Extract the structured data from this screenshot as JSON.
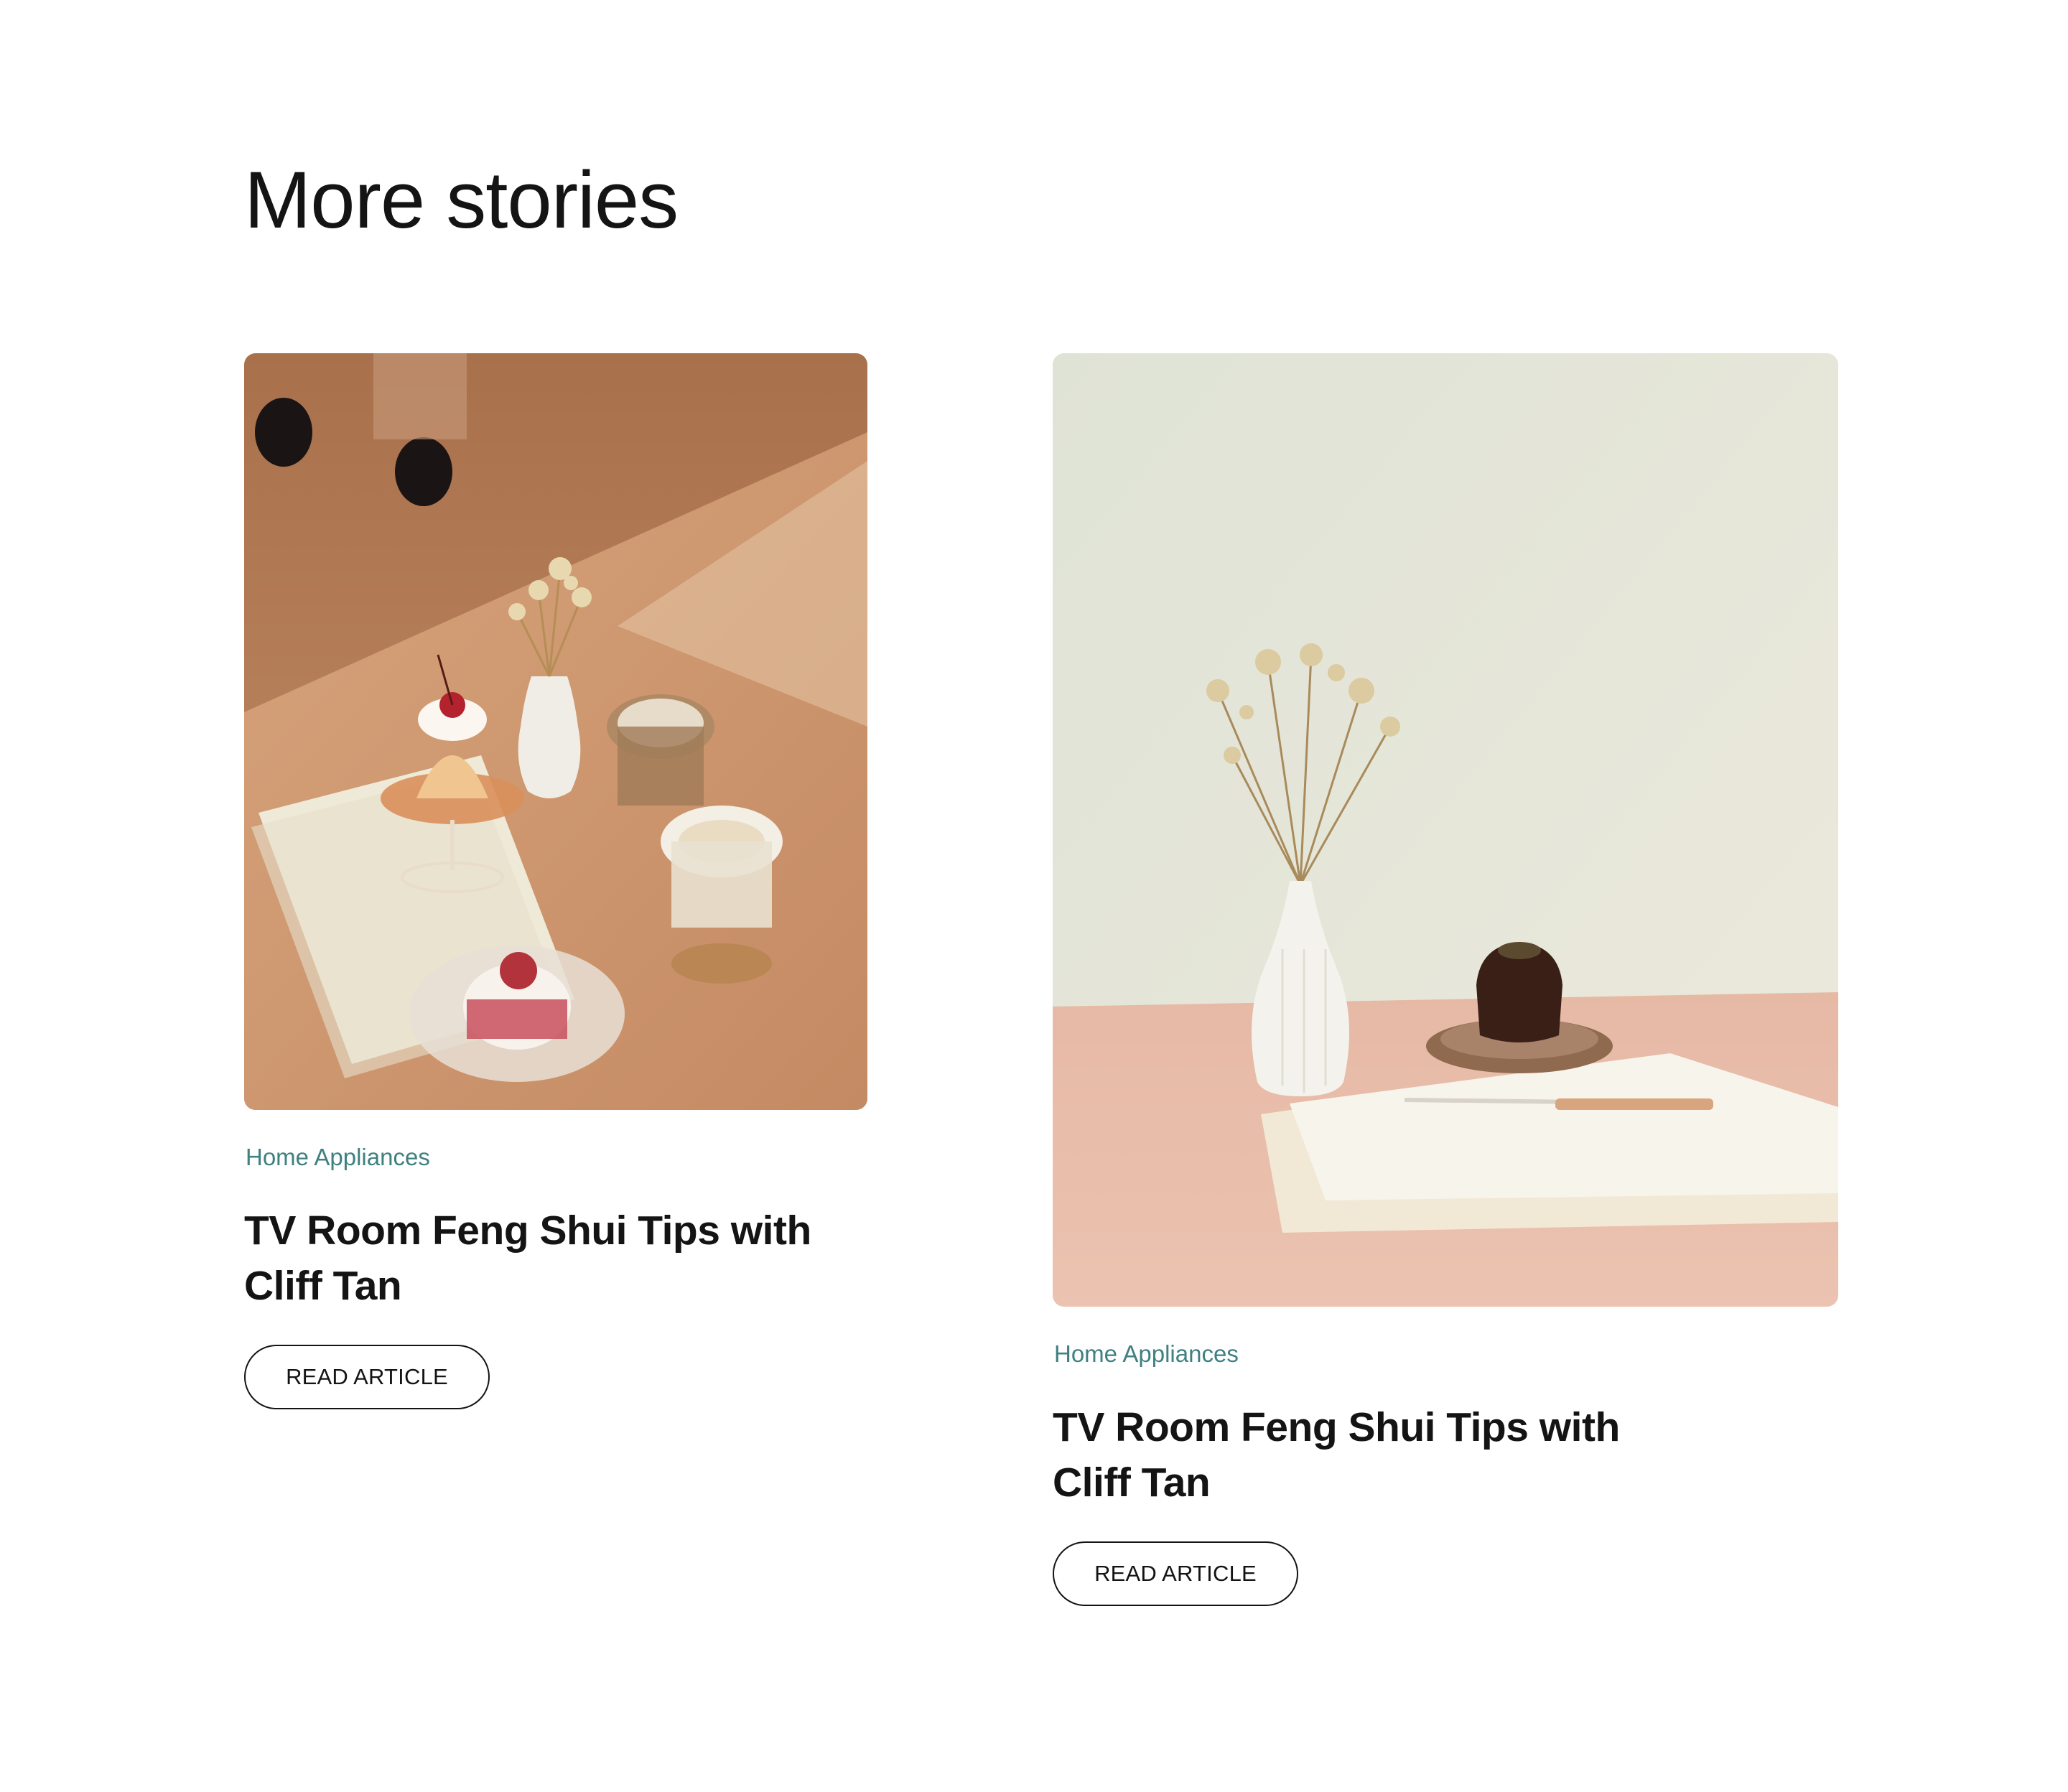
{
  "section": {
    "title": "More stories"
  },
  "stories": [
    {
      "category": "Home Appliances",
      "title": "TV Room Feng Shui Tips with Cliff Tan",
      "button_label": "READ ARTICLE",
      "image_subject": "cafe-table-desserts-photo"
    },
    {
      "category": "Home Appliances",
      "title": "TV Room Feng Shui Tips with Cliff Tan",
      "button_label": "READ ARTICLE",
      "image_subject": "vase-and-cake-still-life-photo"
    }
  ],
  "colors": {
    "category": "#3f8081",
    "text": "#141414",
    "background": "#ffffff"
  }
}
